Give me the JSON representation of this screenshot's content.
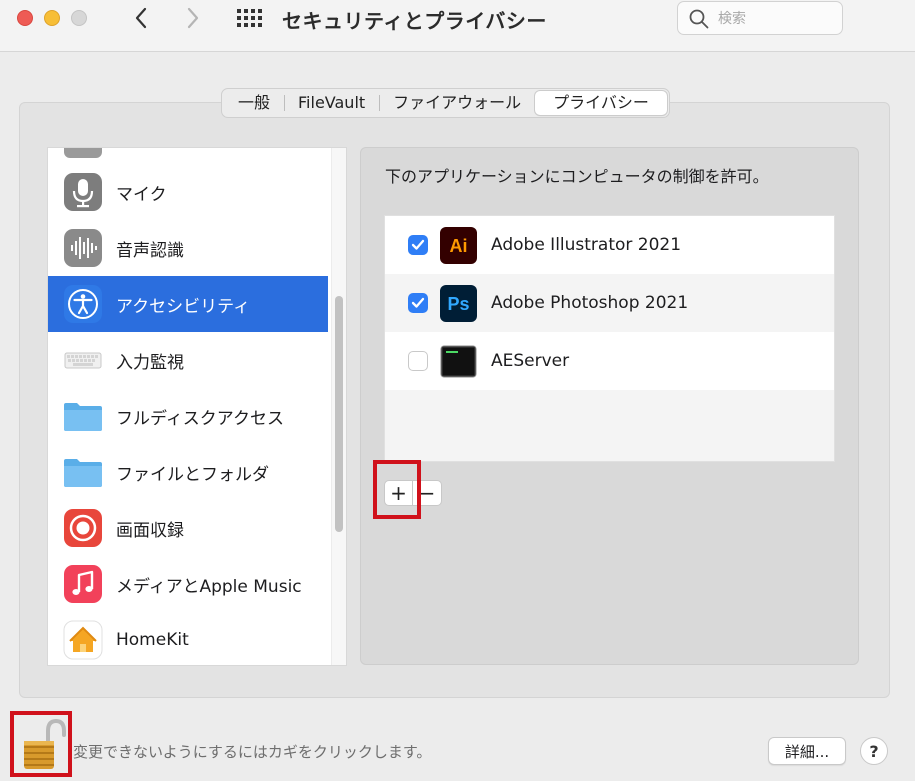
{
  "window": {
    "title": "セキュリティとプライバシー",
    "search_placeholder": "検索"
  },
  "tabs": [
    {
      "label": "一般"
    },
    {
      "label": "FileVault"
    },
    {
      "label": "ファイアウォール"
    },
    {
      "label": "プライバシー",
      "active": true
    }
  ],
  "sidebar": {
    "items": [
      {
        "label": "マイク",
        "icon": "microphone-icon"
      },
      {
        "label": "音声認識",
        "icon": "waveform-icon"
      },
      {
        "label": "アクセシビリティ",
        "icon": "accessibility-icon",
        "selected": true
      },
      {
        "label": "入力監視",
        "icon": "keyboard-icon"
      },
      {
        "label": "フルディスクアクセス",
        "icon": "folder-icon"
      },
      {
        "label": "ファイルとフォルダ",
        "icon": "folder-icon"
      },
      {
        "label": "画面収録",
        "icon": "screen-record-icon"
      },
      {
        "label": "メディアとApple Music",
        "icon": "music-note-icon"
      },
      {
        "label": "HomeKit",
        "icon": "home-icon"
      }
    ]
  },
  "main": {
    "description": "下のアプリケーションにコンピュータの制御を許可。",
    "apps": [
      {
        "name": "Adobe Illustrator 2021",
        "checked": true,
        "icon": "illustrator-icon",
        "icon_text": "Ai"
      },
      {
        "name": "Adobe Photoshop 2021",
        "checked": true,
        "icon": "photoshop-icon",
        "icon_text": "Ps"
      },
      {
        "name": "AEServer",
        "checked": false,
        "icon": "terminal-icon"
      }
    ],
    "add_label": "+",
    "remove_label": "−"
  },
  "footer": {
    "lock_text": "変更できないようにするにはカギをクリックします。",
    "details_label": "詳細...",
    "help_label": "?"
  },
  "colors": {
    "selection": "#2b6ede",
    "checkbox": "#2f7ef6",
    "highlight_box": "#d0111b"
  }
}
